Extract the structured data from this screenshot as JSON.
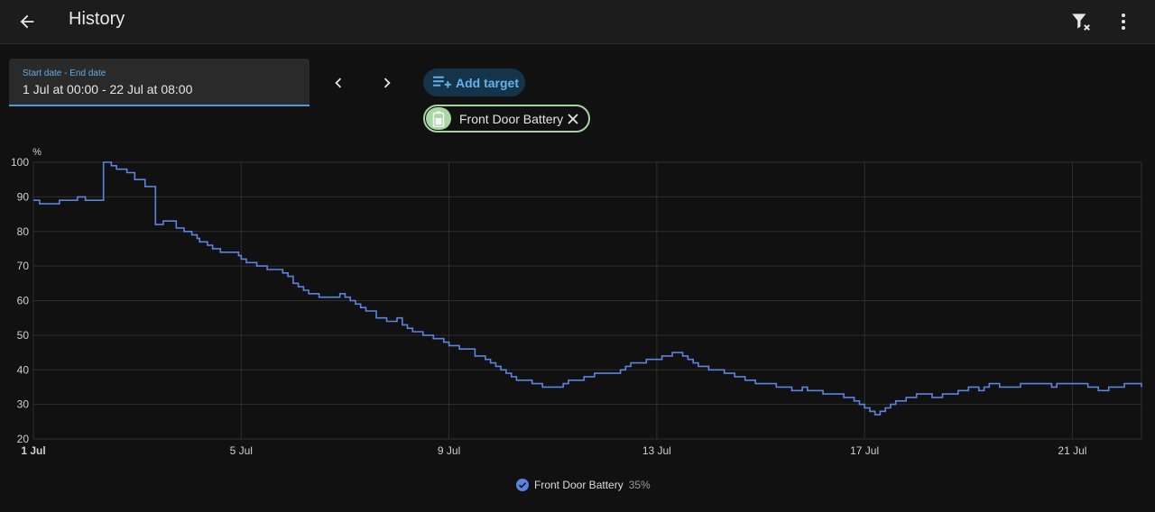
{
  "header": {
    "title": "History",
    "back_icon": "arrow-left-icon",
    "filter_icon": "filter-remove-icon",
    "more_icon": "dots-vertical-icon"
  },
  "date_picker": {
    "label": "Start date - End date",
    "value": "1 Jul at 00:00 - 22 Jul at 08:00"
  },
  "add_target": {
    "label": "Add target",
    "icon": "playlist-plus-icon"
  },
  "target_chip": {
    "label": "Front Door Battery",
    "icon": "battery-icon",
    "color": "#a9d7a5"
  },
  "legend": {
    "name": "Front Door Battery",
    "value": "35%"
  },
  "colors": {
    "accent": "#63b3ed",
    "line": "#5b83e0",
    "background": "#111111"
  },
  "chart_data": {
    "type": "line",
    "step": true,
    "ylabel": "%",
    "ylim": [
      20,
      100
    ],
    "yticks": [
      20,
      30,
      40,
      50,
      60,
      70,
      80,
      90,
      100
    ],
    "xticks": [
      {
        "day": 1,
        "label": "1 Jul",
        "bold": true
      },
      {
        "day": 5,
        "label": "5 Jul"
      },
      {
        "day": 9,
        "label": "9 Jul"
      },
      {
        "day": 13,
        "label": "13 Jul"
      },
      {
        "day": 17,
        "label": "17 Jul"
      },
      {
        "day": 21,
        "label": "21 Jul"
      }
    ],
    "xlim": [
      1,
      22.33
    ],
    "grid": true,
    "series": [
      {
        "name": "Front Door Battery",
        "x": [
          1.0,
          1.12,
          1.5,
          1.85,
          2.0,
          2.35,
          2.5,
          2.6,
          2.8,
          2.95,
          3.15,
          3.35,
          3.5,
          3.5,
          3.6,
          3.75,
          3.9,
          4.05,
          4.15,
          4.2,
          4.35,
          4.45,
          4.6,
          4.95,
          5.0,
          5.1,
          5.3,
          5.5,
          5.8,
          5.9,
          6.0,
          6.1,
          6.2,
          6.3,
          6.5,
          6.9,
          7.0,
          7.1,
          7.2,
          7.3,
          7.4,
          7.6,
          7.8,
          8.0,
          8.1,
          8.2,
          8.3,
          8.5,
          8.7,
          8.9,
          9.0,
          9.2,
          9.5,
          9.7,
          9.8,
          9.9,
          10.0,
          10.1,
          10.2,
          10.3,
          10.6,
          10.8,
          11.2,
          11.3,
          11.6,
          11.8,
          12.3,
          12.4,
          12.5,
          12.8,
          13.1,
          13.3,
          13.5,
          13.6,
          13.7,
          13.8,
          14.0,
          14.3,
          14.5,
          14.7,
          14.9,
          15.3,
          15.6,
          15.8,
          15.9,
          16.2,
          16.6,
          16.8,
          16.9,
          17.0,
          17.1,
          17.2,
          17.3,
          17.4,
          17.5,
          17.6,
          17.8,
          18.0,
          18.3,
          18.5,
          18.8,
          19.0,
          19.2,
          19.3,
          19.4,
          19.6,
          20.0,
          20.6,
          20.7,
          21.3,
          21.5,
          21.7,
          22.0,
          22.33
        ],
        "y": [
          89,
          88,
          89,
          90,
          89,
          100,
          99,
          98,
          97,
          95,
          93,
          82,
          83,
          83,
          83,
          81,
          80,
          79,
          78,
          77,
          76,
          75,
          74,
          73,
          72,
          71,
          70,
          69,
          68,
          67,
          65,
          64,
          63,
          62,
          61,
          62,
          61,
          60,
          59,
          58,
          57,
          55,
          54,
          55,
          53,
          52,
          51,
          50,
          49,
          48,
          47,
          46,
          44,
          43,
          42,
          41,
          40,
          39,
          38,
          37,
          36,
          35,
          36,
          37,
          38,
          39,
          40,
          41,
          42,
          43,
          44,
          45,
          44,
          43,
          42,
          41,
          40,
          39,
          38,
          37,
          36,
          35,
          34,
          35,
          34,
          33,
          32,
          31,
          30,
          29,
          28,
          27,
          28,
          29,
          30,
          31,
          32,
          33,
          32,
          33,
          34,
          35,
          34,
          35,
          36,
          35,
          36,
          35,
          36,
          35,
          34,
          35,
          36,
          35
        ],
        "color": "#5b83e0"
      }
    ]
  }
}
